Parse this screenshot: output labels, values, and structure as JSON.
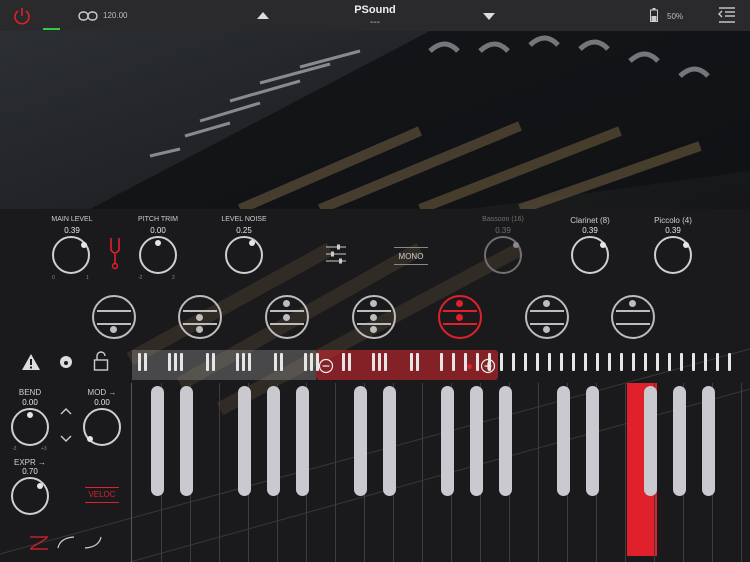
{
  "topbar": {
    "tempo": "120.00",
    "preset_name": "PSound",
    "preset_sub": "---",
    "battery": "50%"
  },
  "knobs": {
    "main_level": {
      "label": "MAIN LEVEL",
      "value": "0.39",
      "min": "0",
      "max": "1"
    },
    "pitch_trim": {
      "label": "PITCH TRIM",
      "value": "0.00",
      "min": "-2",
      "max": "2"
    },
    "level_noise": {
      "label": "LEVEL NOISE",
      "value": "0.25"
    },
    "bassoon": {
      "label": "Bassoon (16)",
      "value": "0.39"
    },
    "clarinet": {
      "label": "Clarinet (8)",
      "value": "0.39"
    },
    "piccolo": {
      "label": "Piccolo (4)",
      "value": "0.39"
    },
    "bend": {
      "label": "BEND",
      "value": "0.00",
      "min": "-3",
      "max": "+3"
    },
    "mod": {
      "label": "MOD →",
      "value": "0.00"
    },
    "expr": {
      "label": "EXPR →",
      "value": "0.70"
    }
  },
  "mono_label": "MONO",
  "veloc_label": "VELOC",
  "colors": {
    "accent": "#e0202a",
    "key": "#c9c9cf",
    "background": "#1a1a1c"
  },
  "icons": [
    "power-icon",
    "link-icon",
    "arrow-up-icon",
    "arrow-down-icon",
    "battery-icon",
    "menu-icon",
    "tuning-fork-icon",
    "mixer-icon",
    "warning-icon",
    "dot-circle-icon",
    "lock-icon",
    "chevron-up-icon",
    "chevron-down-icon",
    "minus-icon",
    "plus-icon"
  ]
}
